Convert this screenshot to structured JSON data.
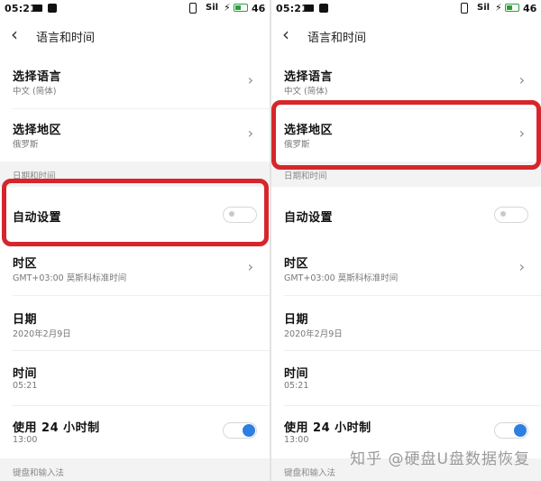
{
  "left": {
    "status": {
      "time": "05:21",
      "signal": "Sil",
      "battery_level": 0.46,
      "battery_text": "46"
    },
    "header": {
      "title": "语言和时间"
    },
    "language_row": {
      "label": "选择语言",
      "value": "中文 (简体)"
    },
    "region_row": {
      "label": "选择地区",
      "value": "俄罗斯"
    },
    "section_datetime": "日期和时间",
    "auto_row": {
      "label": "自动设置",
      "toggle_on": false
    },
    "timezone_row": {
      "label": "时区",
      "value": "GMT+03:00 莫斯科标准时间"
    },
    "date_row": {
      "label": "日期",
      "value": "2020年2月9日"
    },
    "time_row": {
      "label": "时间",
      "value": "05:21"
    },
    "hour24_row": {
      "label": "使用 24 小时制",
      "value": "13:00",
      "toggle_on": true
    },
    "section_keyboard": "键盘和输入法"
  },
  "right": {
    "status": {
      "time": "05:21",
      "signal": "Sil",
      "battery_level": 0.46,
      "battery_text": "46"
    },
    "header": {
      "title": "语言和时间"
    },
    "language_row": {
      "label": "选择语言",
      "value": "中文 (简体)"
    },
    "region_row": {
      "label": "选择地区",
      "value": "俄罗斯"
    },
    "section_datetime": "日期和时间",
    "auto_row": {
      "label": "自动设置",
      "toggle_on": false
    },
    "timezone_row": {
      "label": "时区",
      "value": "GMT+03:00 莫斯科标准时间"
    },
    "date_row": {
      "label": "日期",
      "value": "2020年2月9日"
    },
    "time_row": {
      "label": "时间",
      "value": "05:21"
    },
    "hour24_row": {
      "label": "使用 24 小时制",
      "value": "13:00",
      "toggle_on": true
    },
    "section_keyboard": "键盘和输入法"
  },
  "colors": {
    "highlight": "#d6262b",
    "toggle_on": "#2f7fe0",
    "battery": "#2a9d3a"
  },
  "icons": {
    "back": "chevron-left-icon",
    "row": "chevron-right-icon"
  },
  "watermark": "知乎 @硬盘U盘数据恢复"
}
